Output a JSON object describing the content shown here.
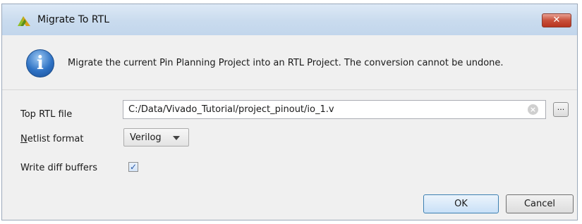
{
  "window": {
    "title": "Migrate To RTL",
    "close_label": "✕"
  },
  "info": {
    "message": "Migrate the current Pin Planning Project into an RTL Project. The conversion cannot be undone."
  },
  "form": {
    "top_rtl_label": "Top RTL file",
    "top_rtl_value": "C:/Data/Vivado_Tutorial/project_pinout/io_1.v",
    "browse_label": "...",
    "netlist_label_mnemonic": "N",
    "netlist_label_rest": "etlist format",
    "netlist_value": "Verilog",
    "diff_label": "Write diff buffers",
    "diff_checked": "✓"
  },
  "buttons": {
    "ok": "OK",
    "cancel": "Cancel"
  },
  "colors": {
    "titlebar": "#c9dbee",
    "close": "#c8503a",
    "info_icon": "#2f72c4",
    "dialog_bg": "#f0f0f0"
  }
}
